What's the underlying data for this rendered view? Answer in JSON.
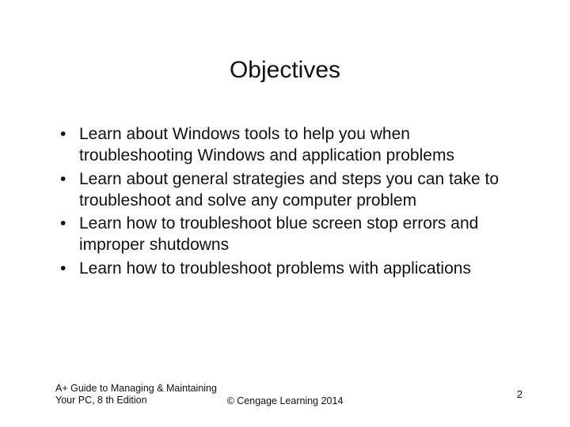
{
  "title": "Objectives",
  "bullets": [
    "Learn about Windows tools to help you when troubleshooting Windows and application problems",
    "Learn about general strategies and steps you can take to troubleshoot and solve any computer problem",
    "Learn how to troubleshoot blue screen stop errors and improper shutdowns",
    "Learn how to troubleshoot problems with applications"
  ],
  "footer": {
    "left": "A+ Guide to Managing & Maintaining Your PC, 8 th Edition",
    "center": "© Cengage Learning  2014",
    "right": "2"
  }
}
